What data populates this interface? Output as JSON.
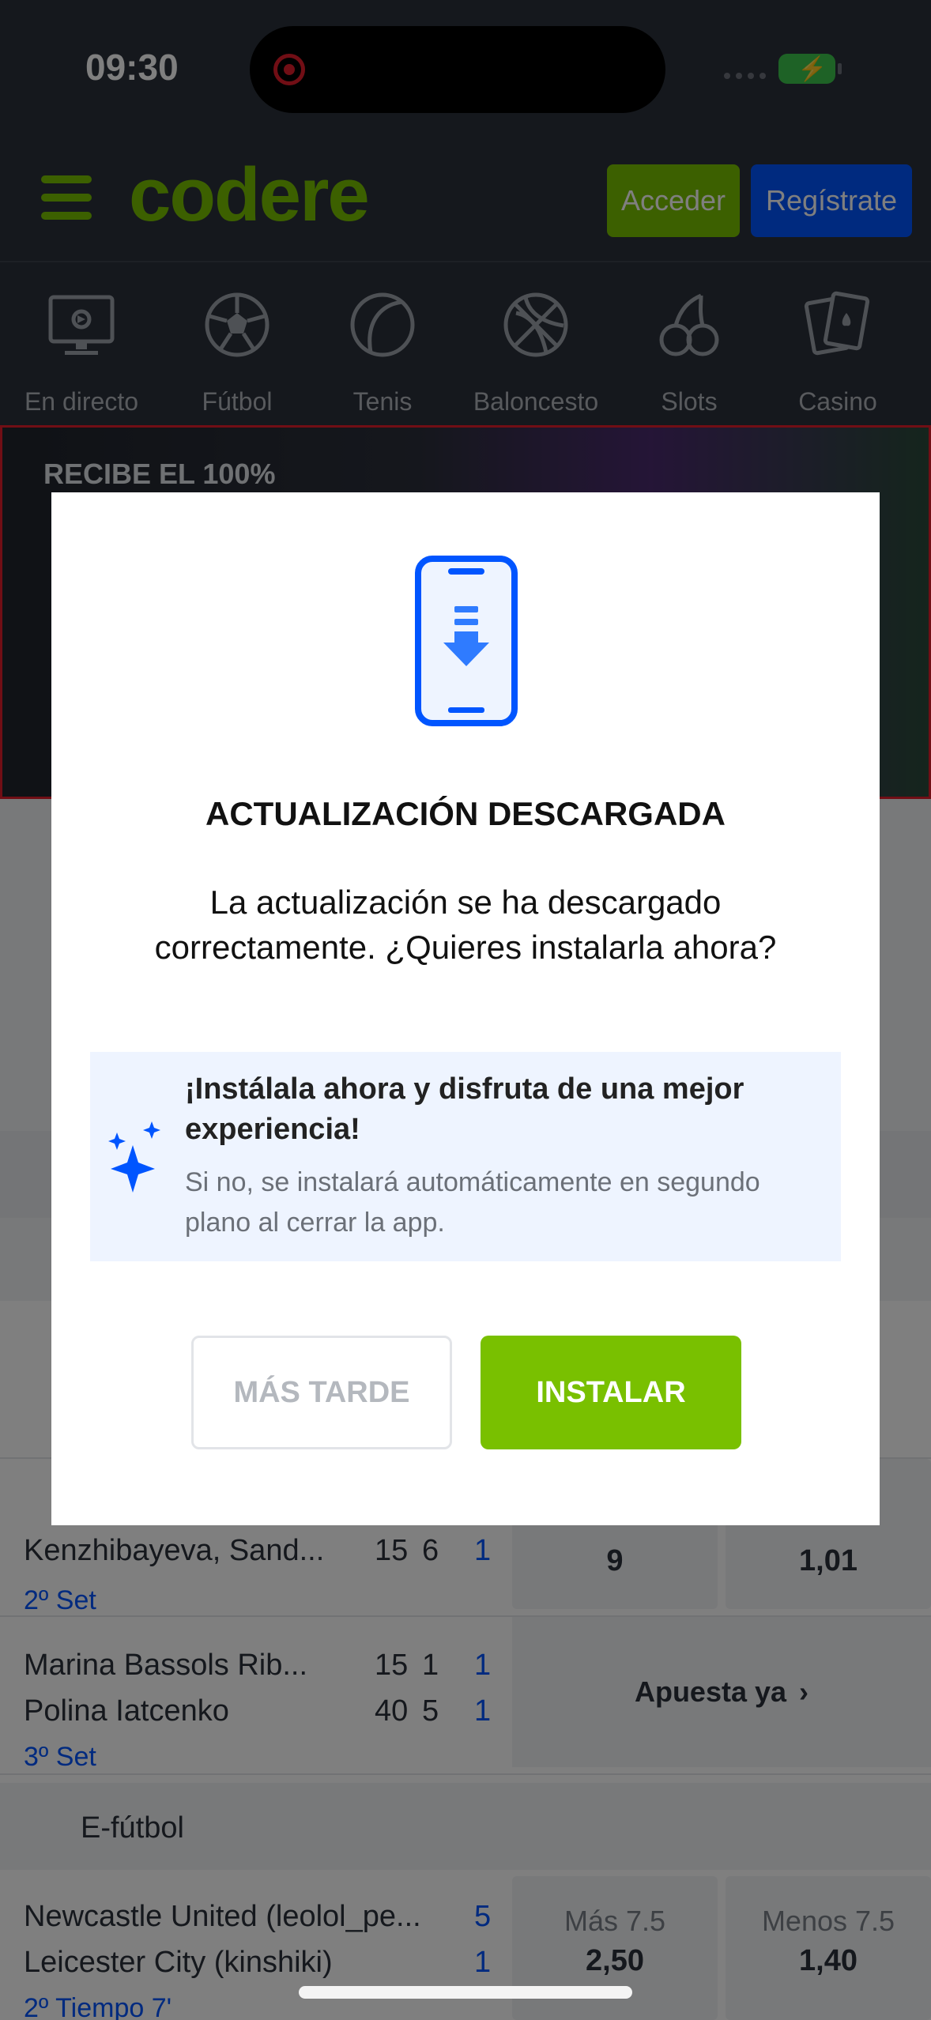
{
  "status_bar": {
    "time": "09:30"
  },
  "header": {
    "logo": "codere",
    "login_label": "Acceder",
    "register_label": "Regístrate"
  },
  "categories": [
    {
      "label": "En directo",
      "icon": "live-tv-icon"
    },
    {
      "label": "Fútbol",
      "icon": "soccer-ball-icon"
    },
    {
      "label": "Tenis",
      "icon": "tennis-ball-icon"
    },
    {
      "label": "Baloncesto",
      "icon": "basketball-icon"
    },
    {
      "label": "Slots",
      "icon": "cherries-icon"
    },
    {
      "label": "Casino",
      "icon": "playing-cards-icon"
    }
  ],
  "banner": {
    "headline": "RECIBE EL 100%"
  },
  "background": {
    "tennis_rows": [
      {
        "p1": "Kenzhibayeva, Sand...",
        "s1": "15",
        "s2": "6",
        "s3": "1",
        "set": "2º Set",
        "odd_a": "9",
        "odd_b": "1,01"
      },
      {
        "p1": "Marina Bassols Rib...",
        "p2": "Polina Iatcenko",
        "a1": "15",
        "a2": "1",
        "a3": "1",
        "b1": "40",
        "b2": "5",
        "b3": "1",
        "set": "3º Set",
        "cta": "Apuesta ya"
      }
    ],
    "efutbol": {
      "title": "E-fútbol",
      "team1": "Newcastle United (leolol_pe...",
      "score1": "5",
      "team2": "Leicester City (kinshiki)",
      "score2": "1",
      "period": "2º Tiempo 7'",
      "over_label": "Más 7.5",
      "over_odd": "2,50",
      "under_label": "Menos 7.5",
      "under_odd": "1,40"
    }
  },
  "modal": {
    "title": "ACTUALIZACIÓN DESCARGADA",
    "message": "La actualización se ha descargado correctamente. ¿Quieres instalarla ahora?",
    "info_head": "¡Instálala ahora y disfruta de una mejor experiencia!",
    "info_sub": "Si no, se instalará automáticamente en segundo plano al cerrar la app.",
    "later_label": "MÁS TARDE",
    "install_label": "INSTALAR"
  },
  "colors": {
    "brand_green": "#79c000",
    "brand_blue": "#0055ff",
    "header_bg": "#2b303a"
  }
}
